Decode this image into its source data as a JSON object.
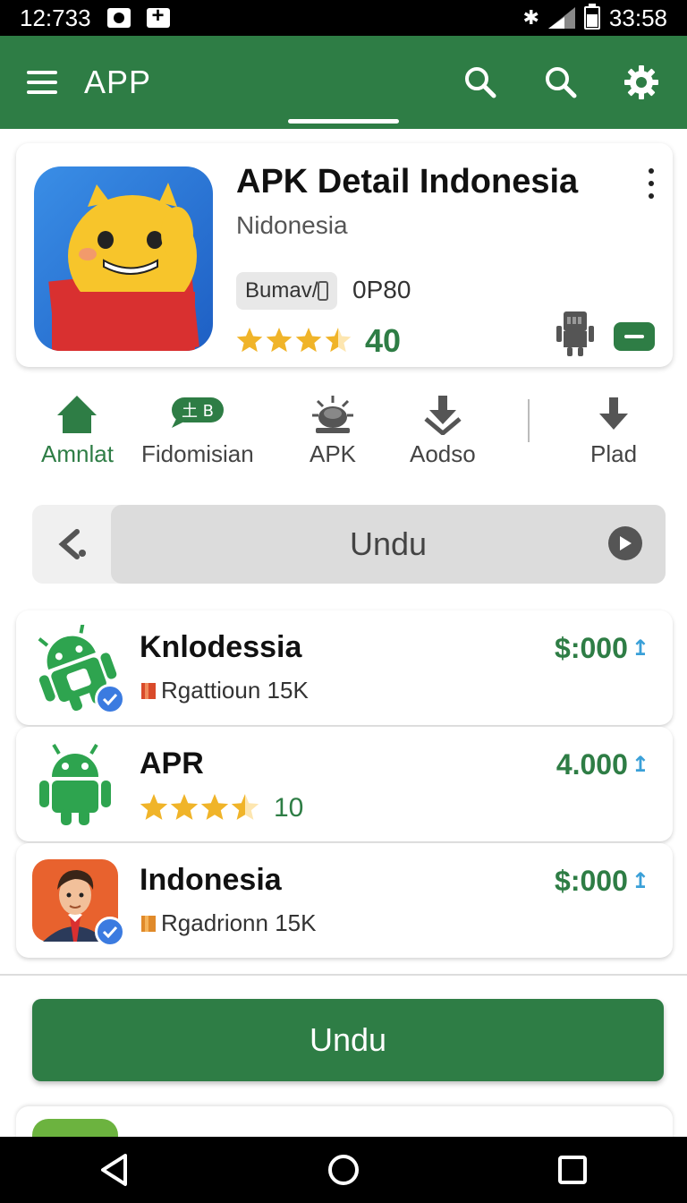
{
  "status_bar": {
    "time": "12:733",
    "right_time": "33:58",
    "icons": [
      "camera-icon",
      "plus-icon",
      "bluetooth-icon",
      "signal-icon",
      "battery-icon"
    ]
  },
  "app_bar": {
    "title": "APP",
    "actions": [
      "search-icon",
      "search-icon",
      "gear-icon"
    ],
    "color": "#2e7d45"
  },
  "detail": {
    "title": "APK Detail Indonesia",
    "subtitle": "Nidonesia",
    "tag": "Bumav/",
    "code": "0P80",
    "rating": 3.5,
    "rating_value": "40"
  },
  "categories": [
    {
      "label": "Amnlat",
      "icon": "home-icon",
      "active": true
    },
    {
      "label": "Fidomisian",
      "icon": "chat-icon",
      "badge": "土 B",
      "active": false
    },
    {
      "label": "APK",
      "icon": "bug-icon",
      "active": false
    },
    {
      "label": "Aodso",
      "icon": "download-icon",
      "active": false
    },
    {
      "label": "Plad",
      "icon": "arrow-down-icon",
      "active": false
    }
  ],
  "undu_bar": {
    "label": "Undu"
  },
  "list": [
    {
      "title": "Knlodessia",
      "subtitle": "Rgattioun 15K",
      "price": "$:000",
      "type": "subtitle",
      "icon": "android-icon",
      "verified": true
    },
    {
      "title": "APR",
      "rating": 3.5,
      "rating_value": "10",
      "price": "4.000",
      "type": "rating",
      "icon": "android-icon",
      "verified": false
    },
    {
      "title": "Indonesia",
      "subtitle": "Rgadrionn 15K",
      "price": "$:000",
      "type": "subtitle",
      "icon": "person-avatar-icon",
      "verified": true
    }
  ],
  "primary_button": {
    "label": "Undu"
  },
  "nav_bar": {
    "buttons": [
      "back-icon",
      "home-icon",
      "recents-icon"
    ]
  }
}
